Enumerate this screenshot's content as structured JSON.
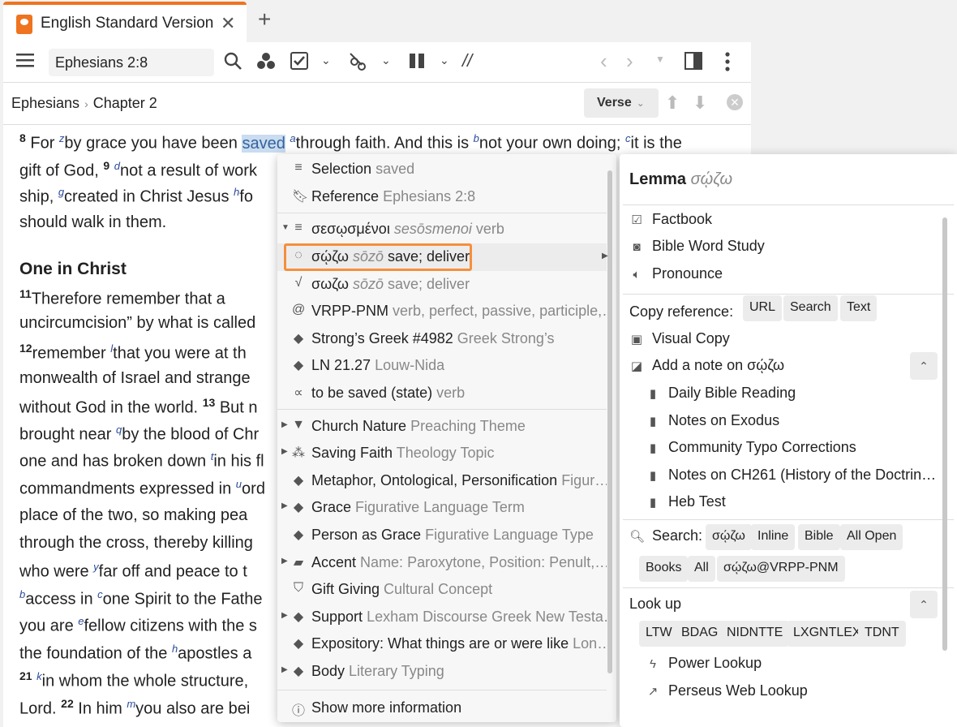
{
  "tab": {
    "title": "English Standard Version",
    "close": "✕",
    "add": "+"
  },
  "toolbar": {
    "reference_value": "Ephesians 2:8",
    "parallel_icon": "//"
  },
  "breadcrumb": {
    "book": "Ephesians",
    "chapter": "Chapter 2",
    "sep": "›"
  },
  "verse_button": {
    "label": "Verse"
  },
  "passage": {
    "heading": "One in Christ",
    "l1": {
      "vn": "8",
      "a": " For ",
      "fz": "z",
      "b": "by grace you have been ",
      "hl": "saved",
      "fa": "a",
      "c": "through faith. And this is ",
      "fb": "b",
      "d": "not your own doing; ",
      "fc": "c",
      "e": "it is the"
    },
    "l2": {
      "a": "gift of God, ",
      "vn": "9",
      "fd": "d",
      "b": "not a result of work"
    },
    "l3": {
      "a": "ship, ",
      "fg": "g",
      "b": "created in Christ Jesus ",
      "fh": "h",
      "c": "fo"
    },
    "l4": "should walk in them.",
    "l6": {
      "vn": "11",
      "a": "Therefore  remember  that  a"
    },
    "l7": "uncircumcision” by what is called",
    "l8": {
      "vn": "12",
      "a": "remember ",
      "fl": "l",
      "b": "that you were at th"
    },
    "l9": "monwealth  of  Israel  and  strange",
    "l10": {
      "a": "without God in the world. ",
      "vn": "13",
      "b": " But n"
    },
    "l11": {
      "a": "brought near ",
      "fq": "q",
      "b": "by the blood of Chr"
    },
    "l12": {
      "a": "one and has broken down ",
      "ft": "t",
      "b": "in his fl"
    },
    "l13": {
      "a": "commandments expressed in ",
      "fu": "u",
      "b": "ord"
    },
    "l14": "place  of  the  two,  so  making  pea",
    "l15": "through the cross, thereby killing",
    "l16": {
      "a": "who  were  ",
      "fy": "y",
      "b": "far  off  and  peace  to  t"
    },
    "l17": {
      "fb2": "b",
      "a": "access in ",
      "fc2": "c",
      "b": "one Spirit to the Fathe"
    },
    "l18": {
      "a": "you are ",
      "fe": "e",
      "b": "fellow citizens with the s"
    },
    "l19": {
      "a": "the  foundation  of  the  ",
      "fh2": "h",
      "b": "apostles  a"
    },
    "l20": {
      "vn": "21",
      "fk": "k",
      "a": "in  whom  the  whole  structure,"
    },
    "l21": {
      "a": "Lord. ",
      "vn": "22",
      "b": " In him ",
      "fm": "m",
      "c": "you also are bei"
    }
  },
  "context_menu": {
    "items": [
      {
        "label": "Selection",
        "sub": "saved"
      },
      {
        "label": "Reference",
        "sub": "Ephesians 2:8"
      },
      {
        "label": "σεσῳσμένοι",
        "sub_i": "sesōsmenoi",
        "sub": "verb"
      },
      {
        "label": "σῴζω",
        "sub_i": "sōzō",
        "sub": "save; deliver"
      },
      {
        "label": "σωζω",
        "sub_i": "sōzō",
        "sub": "save; deliver"
      },
      {
        "label": "VRPP-PNM",
        "sub": "verb, perfect, passive, participle,…"
      },
      {
        "label": "Strong’s Greek #4982",
        "sub": "Greek Strong’s"
      },
      {
        "label": "LN 21.27",
        "sub": "Louw-Nida"
      },
      {
        "label": "to be saved (state)",
        "sub": "verb"
      },
      {
        "label": "Church Nature",
        "sub": "Preaching Theme"
      },
      {
        "label": "Saving Faith",
        "sub": "Theology Topic"
      },
      {
        "label": "Metaphor, Ontological, Personification",
        "sub": "Figur…"
      },
      {
        "label": "Grace",
        "sub": "Figurative Language Term"
      },
      {
        "label": "Person as Grace",
        "sub": "Figurative Language Type"
      },
      {
        "label": "Accent",
        "sub": "Name: Paroxytone, Position: Penult,…"
      },
      {
        "label": "Gift Giving",
        "sub": "Cultural Concept"
      },
      {
        "label": "Support",
        "sub": "Lexham Discourse Greek New Testa…"
      },
      {
        "label": "Expository: What things are or were like",
        "sub": "Lon…"
      },
      {
        "label": "Body",
        "sub": "Literary Typing"
      }
    ],
    "show_more": "Show more information"
  },
  "right_panel": {
    "title": "Lemma",
    "title_sub": "σῴζω",
    "factbook": "Factbook",
    "bible_word_study": "Bible Word Study",
    "pronounce": "Pronounce",
    "copy_reference": "Copy reference:",
    "copy_chips": [
      "URL",
      "Search",
      "Text"
    ],
    "visual_copy": "Visual Copy",
    "add_note": "Add a note on σῴζω",
    "notebooks": [
      "Daily Bible Reading",
      "Notes on Exodus",
      "Community Typo Corrections",
      "Notes on CH261 (History of the Doctrin…",
      "Heb Test"
    ],
    "search_label": "Search:",
    "search_chips": [
      "σῴζω",
      "Inline",
      "Bible",
      "All Open",
      "Books",
      "All",
      "σῴζω@VRPP-PNM"
    ],
    "lookup_label": "Look up",
    "lookup_chips": [
      "LTW",
      "BDAG",
      "NIDNTTE",
      "LXGNTLEX",
      "TDNT"
    ],
    "power_lookup": "Power Lookup",
    "perseus": "Perseus Web Lookup"
  }
}
